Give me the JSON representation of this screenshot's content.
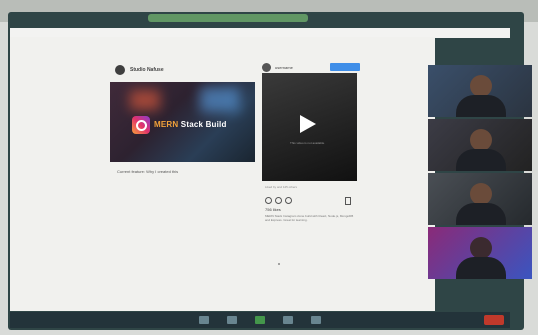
{
  "window": {
    "title": ""
  },
  "post1": {
    "account_name": "Studio Nafuse",
    "image_text_primary": "MERN",
    "image_text_secondary": "Stack Build",
    "caption": "Current feature: Why I created this"
  },
  "post2": {
    "account_name": "username",
    "follow_label": "",
    "video_caption": "This video is not available",
    "meta": "Liked by and 125 others",
    "likes": "756 likes",
    "description": "MERN Stack Instagram clone build with React, Node.js, MongoDB and Express. Great for learning."
  },
  "footer": {
    "left": "",
    "right": ""
  },
  "participants": [
    {
      "name": ""
    },
    {
      "name": ""
    },
    {
      "name": ""
    },
    {
      "name": ""
    }
  ],
  "colors": {
    "accent": "#3f8ee8",
    "instagram_gradient": [
      "#f9a13b",
      "#e2336b",
      "#8b3bd1"
    ],
    "end_call": "#c0392b"
  }
}
